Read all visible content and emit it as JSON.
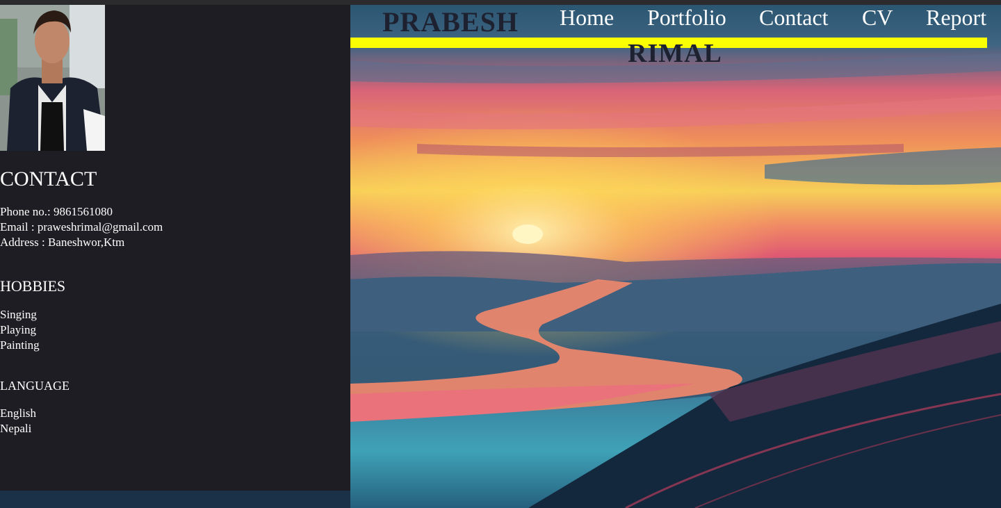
{
  "header": {
    "name_first": "PRABESH",
    "name_last": "RIMAL",
    "nav": [
      "Home",
      "Portfolio",
      "Contact",
      "CV",
      "Report"
    ]
  },
  "sidebar": {
    "photo_icon": "profile-photo",
    "contact": {
      "title": "CONTACT",
      "lines": [
        "Phone no.: 9861561080",
        "Email : praweshrimal@gmail.com",
        "Address : Baneshwor,Ktm"
      ]
    },
    "hobbies": {
      "title": "HOBBIES",
      "items": [
        "Singing",
        "Playing",
        "Painting"
      ]
    },
    "language": {
      "title": "LANGUAGE",
      "items": [
        "English",
        "Nepali"
      ]
    }
  },
  "colors": {
    "panel_bg": "#1e1d23",
    "accent_bar": "#fbff03",
    "brand_text": "#1e2230",
    "nav_text": "#ffffff"
  }
}
